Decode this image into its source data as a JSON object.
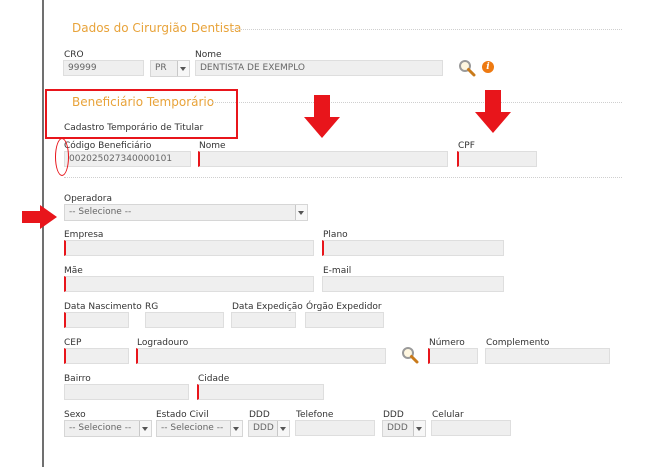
{
  "sections": {
    "dentist_title": "Dados do Cirurgião Dentista",
    "beneficiary_title": "Beneficiário Temporário",
    "beneficiary_subtitle": "Cadastro Temporário de Titular"
  },
  "dentist": {
    "cro_label": "CRO",
    "cro_value": "99999",
    "uf_value": "PR",
    "name_label": "Nome",
    "name_value": "DENTISTA DE EXEMPLO"
  },
  "beneficiary": {
    "code_label": "Código Beneficiário",
    "code_value": "002025027340000101",
    "name_label": "Nome",
    "cpf_label": "CPF"
  },
  "form": {
    "operadora_label": "Operadora",
    "operadora_value": "-- Selecione --",
    "empresa_label": "Empresa",
    "plano_label": "Plano",
    "mae_label": "Mãe",
    "email_label": "E-mail",
    "data_nasc_label": "Data Nascimento",
    "rg_label": "RG",
    "data_exp_label": "Data Expedição",
    "orgao_label": "Órgão Expedidor",
    "cep_label": "CEP",
    "logradouro_label": "Logradouro",
    "numero_label": "Número",
    "complemento_label": "Complemento",
    "bairro_label": "Bairro",
    "cidade_label": "Cidade",
    "sexo_label": "Sexo",
    "sexo_value": "-- Selecione --",
    "estado_civil_label": "Estado Civil",
    "estado_civil_value": "-- Selecione --",
    "ddd1_label": "DDD",
    "ddd1_value": "DDD",
    "telefone_label": "Telefone",
    "ddd2_label": "DDD",
    "ddd2_value": "DDD",
    "celular_label": "Celular"
  },
  "colors": {
    "accent": "#e8a33a",
    "required": "#e8151b",
    "annotation": "#e8151b",
    "info_icon": "#ee7a12"
  },
  "icons": [
    "search-icon",
    "info-icon",
    "arrow-down-icon",
    "arrow-right-icon"
  ]
}
